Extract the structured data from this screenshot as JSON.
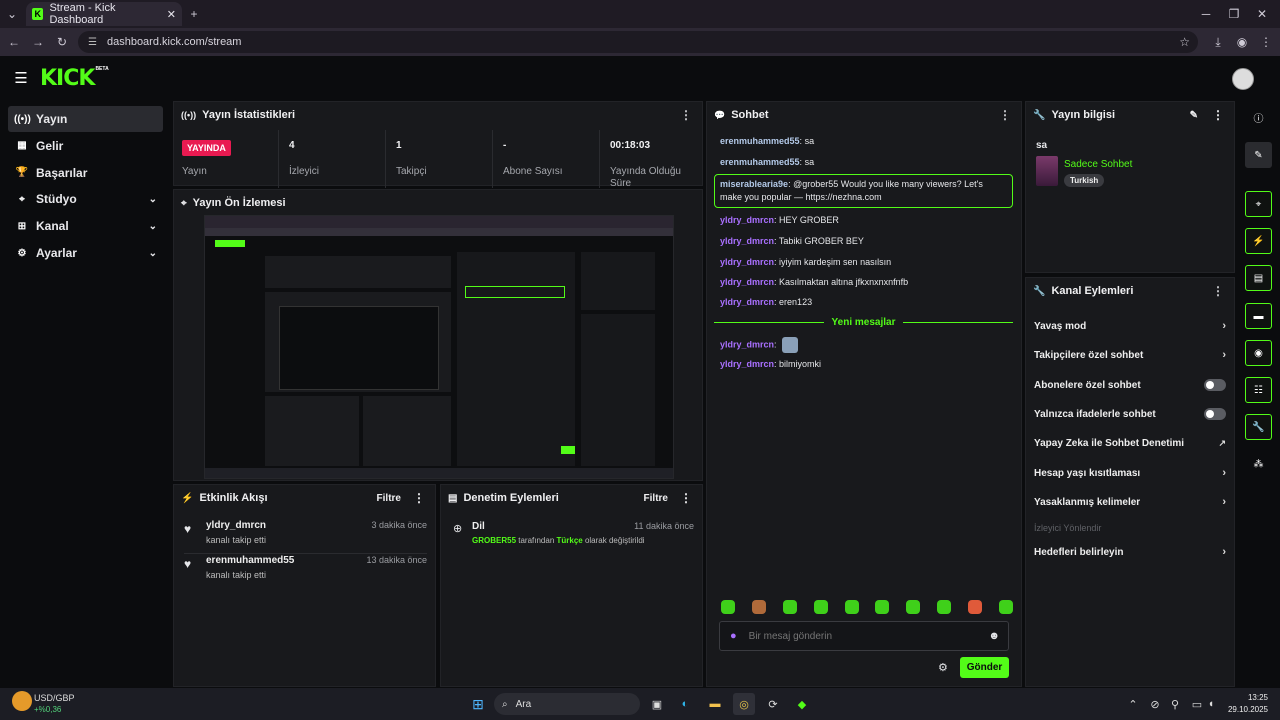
{
  "browser": {
    "tab_title": "Stream - Kick Dashboard",
    "url": "dashboard.kick.com/stream"
  },
  "app": {
    "logo": "KICK",
    "logo_badge": "BETA"
  },
  "sidebar": {
    "items": [
      {
        "label": "Yayın",
        "icon": "broadcast-icon",
        "active": true
      },
      {
        "label": "Gelir",
        "icon": "revenue-icon"
      },
      {
        "label": "Başarılar",
        "icon": "trophy-icon"
      },
      {
        "label": "Stüdyo",
        "icon": "studio-icon",
        "expandable": true
      },
      {
        "label": "Kanal",
        "icon": "channel-icon",
        "expandable": true
      },
      {
        "label": "Ayarlar",
        "icon": "gear-icon",
        "expandable": true
      }
    ]
  },
  "stats": {
    "title": "Yayın İstatistikleri",
    "live_badge": "YAYINDA",
    "live_label": "Yayın",
    "viewers": {
      "value": "4",
      "label": "İzleyici"
    },
    "followers": {
      "value": "1",
      "label": "Takipçi"
    },
    "subs": {
      "value": "-",
      "label": "Abone Sayısı"
    },
    "duration": {
      "value": "00:18:03",
      "label": "Yayında Olduğu Süre"
    }
  },
  "preview": {
    "title": "Yayın Ön İzlemesi"
  },
  "activity": {
    "title": "Etkinlik Akışı",
    "filter": "Filtre",
    "events": [
      {
        "user": "yldry_dmrcn",
        "text": "kanalı takip etti",
        "time": "3 dakika önce"
      },
      {
        "user": "erenmuhammed55",
        "text": "kanalı takip etti",
        "time": "13 dakika önce"
      }
    ]
  },
  "moderation": {
    "title": "Denetim Eylemleri",
    "filter": "Filtre",
    "items": [
      {
        "title": "Dil",
        "time": "11 dakika önce",
        "actor": "GROBER55",
        "mid": " tarafından ",
        "value": "Türkçe",
        "end": " olarak değiştirildi"
      }
    ]
  },
  "chat": {
    "title": "Sohbet",
    "messages": [
      {
        "user": "erenmuhammed55",
        "text": "sa",
        "color": "#b3c9e8"
      },
      {
        "user": "erenmuhammed55",
        "text": "sa",
        "color": "#b3c9e8"
      },
      {
        "user": "miserablearia9e",
        "text": "@grober55 Would you like many viewers? Let's make you popular — https://nezhna.com",
        "color": "#b3c9e8",
        "highlight": true
      },
      {
        "user": "yldry_dmrcn",
        "text": "HEY GROBER",
        "color": "#a970ff"
      },
      {
        "user": "yldry_dmrcn",
        "text": "Tabiki GROBER BEY",
        "color": "#a970ff"
      },
      {
        "user": "yldry_dmrcn",
        "text": "iyiyim kardeşim sen nasılsın",
        "color": "#a970ff"
      },
      {
        "user": "yldry_dmrcn",
        "text": "Kasılmaktan altına jfkxnxnxnfnfb",
        "color": "#a970ff"
      },
      {
        "user": "yldry_dmrcn",
        "text": "eren123",
        "color": "#a970ff"
      }
    ],
    "new_messages": "Yeni mesajlar",
    "messages_after": [
      {
        "user": "yldry_dmrcn",
        "text": "",
        "emote": true,
        "color": "#a970ff"
      },
      {
        "user": "yldry_dmrcn",
        "text": "bilmiyomki",
        "color": "#a970ff"
      }
    ],
    "input_placeholder": "Bir mesaj gönderin",
    "send": "Gönder",
    "emote_count": 10
  },
  "stream_info": {
    "title": "Yayın bilgisi",
    "stream_title": "sa",
    "category": "Sadece Sohbet",
    "tag": "Turkish"
  },
  "channel_actions": {
    "title": "Kanal Eylemleri",
    "items": [
      {
        "label": "Yavaş mod",
        "kind": "arrow"
      },
      {
        "label": "Takipçilere özel sohbet",
        "kind": "arrow"
      },
      {
        "label": "Abonelere özel sohbet",
        "kind": "toggle"
      },
      {
        "label": "Yalnızca ifadelerle sohbet",
        "kind": "toggle"
      },
      {
        "label": "Yapay Zeka ile Sohbet Denetimi",
        "kind": "external"
      },
      {
        "label": "Hesap yaşı kısıtlaması",
        "kind": "arrow"
      },
      {
        "label": "Yasaklanmış kelimeler",
        "kind": "arrow"
      },
      {
        "label": "İzleyici Yönlendir",
        "kind": "disabled"
      },
      {
        "label": "Hedefleri belirleyin",
        "kind": "arrow"
      }
    ]
  },
  "taskbar": {
    "ticker": "USD/GBP",
    "ticker_change": "+%0,36",
    "search": "Ara",
    "time": "13:25",
    "date": "29.10.2025"
  },
  "colors": {
    "accent": "#53fc18",
    "live": "#e91a51",
    "panel": "#18191c"
  }
}
